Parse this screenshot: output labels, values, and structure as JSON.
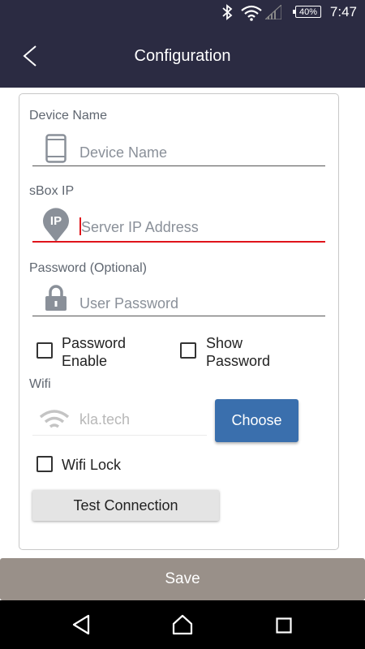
{
  "status_bar": {
    "time": "7:47",
    "battery": "40%"
  },
  "app_bar": {
    "title": "Configuration"
  },
  "form": {
    "device_name_label": "Device Name",
    "device_name_placeholder": "Device Name",
    "device_name_value": "",
    "sbox_ip_label": "sBox IP",
    "ip_badge": "IP",
    "server_ip_placeholder": "Server IP Address",
    "server_ip_value": "",
    "password_label": "Password (Optional)",
    "password_placeholder": "User Password",
    "password_value": "",
    "password_enable_line1": "Password",
    "password_enable_line2": "Enable",
    "password_enable_checked": false,
    "show_password_line1": "Show",
    "show_password_line2": "Password",
    "show_password_checked": false,
    "wifi_label": "Wifi",
    "wifi_value": "kla.tech",
    "choose_label": "Choose",
    "wifi_lock_label": "Wifi Lock",
    "wifi_lock_checked": false,
    "test_connection_label": "Test Connection"
  },
  "save_label": "Save",
  "colors": {
    "app_bar": "#2b2b42",
    "active_underline": "#e0141b",
    "choose_button": "#3a6fad",
    "save_button": "#999089"
  },
  "icons": {
    "back": "chevron-left-icon",
    "device": "smartphone-icon",
    "ip": "ip-pin-icon",
    "password": "lock-icon",
    "wifi": "wifi-icon",
    "nav_back": "triangle-back-icon",
    "nav_home": "home-icon",
    "nav_recents": "square-recents-icon"
  }
}
